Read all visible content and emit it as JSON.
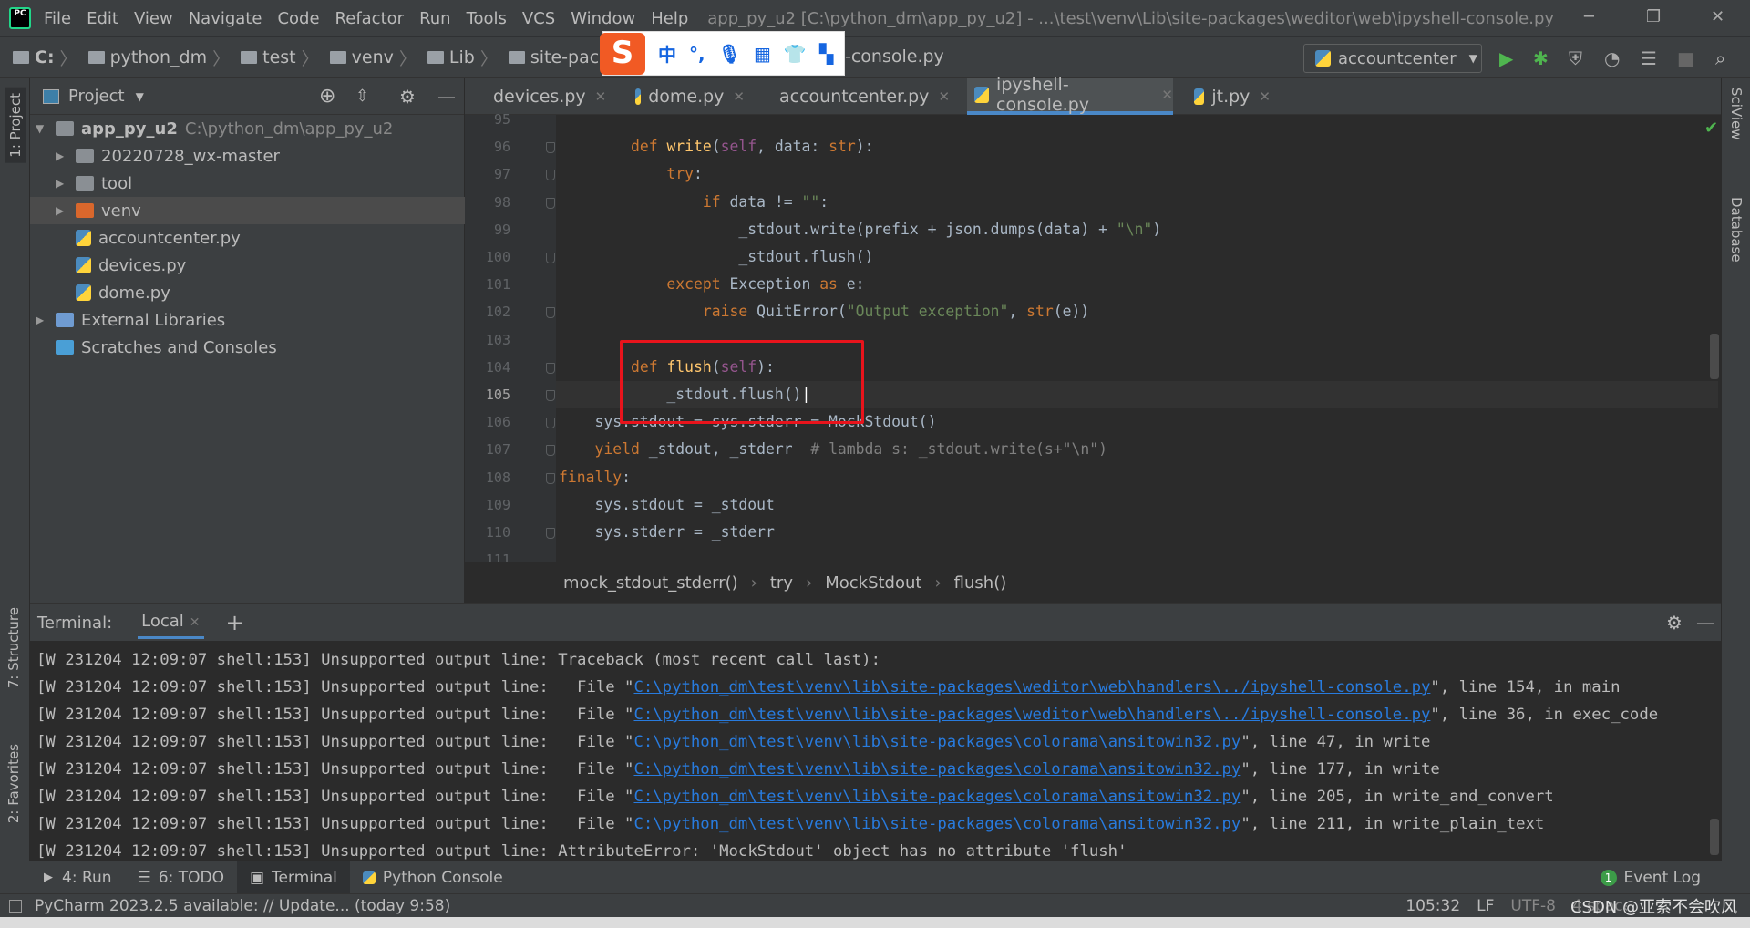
{
  "menubar": {
    "items": [
      "File",
      "Edit",
      "View",
      "Navigate",
      "Code",
      "Refactor",
      "Run",
      "Tools",
      "VCS",
      "Window",
      "Help"
    ],
    "title": "app_py_u2 [C:\\python_dm\\app_py_u2] - ...\\test\\venv\\Lib\\site-packages\\weditor\\web\\ipyshell-console.py"
  },
  "navbar": {
    "crumbs": [
      "C:",
      "python_dm",
      "test",
      "venv",
      "Lib",
      "site-packages",
      "w"
    ],
    "tail": "-console.py",
    "run_config": "accountcenter"
  },
  "ime": {
    "logo": "S",
    "items": [
      "中",
      "°,",
      "mic",
      "keyboard",
      "shirt",
      "grid"
    ]
  },
  "left_strip": {
    "project": "1: Project",
    "structure": "7: Structure",
    "favorites": "2: Favorites"
  },
  "right_strip": {
    "sciview": "SciView",
    "database": "Database"
  },
  "project": {
    "title": "Project",
    "tree": [
      {
        "label": "app_py_u2",
        "hint": "C:\\python_dm\\app_py_u2",
        "type": "folder",
        "depth": 0,
        "expanded": true
      },
      {
        "label": "20220728_wx-master",
        "type": "folder",
        "depth": 1,
        "expanded": false
      },
      {
        "label": "tool",
        "type": "folder",
        "depth": 1,
        "expanded": false
      },
      {
        "label": "venv",
        "type": "venv",
        "depth": 1,
        "expanded": false,
        "selected": true
      },
      {
        "label": "accountcenter.py",
        "type": "py",
        "depth": 1
      },
      {
        "label": "devices.py",
        "type": "py",
        "depth": 1
      },
      {
        "label": "dome.py",
        "type": "py",
        "depth": 1
      },
      {
        "label": "External Libraries",
        "type": "lib",
        "depth": 0,
        "expanded": false
      },
      {
        "label": "Scratches and Consoles",
        "type": "scratch",
        "depth": 0
      }
    ]
  },
  "tabs": [
    {
      "label": "devices.py"
    },
    {
      "label": "dome.py"
    },
    {
      "label": "accountcenter.py"
    },
    {
      "label": "ipyshell-console.py",
      "active": true
    },
    {
      "label": "jt.py"
    }
  ],
  "code": {
    "current_line": 105,
    "lines": [
      {
        "n": 95,
        "t": []
      },
      {
        "n": 96,
        "t": [
          [
            "",
            "        "
          ],
          [
            "k",
            "def "
          ],
          [
            "f",
            "write"
          ],
          [
            "",
            "("
          ],
          [
            "sf",
            "self"
          ],
          [
            "",
            ", data: "
          ],
          [
            "k",
            "str"
          ],
          [
            "",
            "):"
          ]
        ]
      },
      {
        "n": 97,
        "t": [
          [
            "",
            "            "
          ],
          [
            "k",
            "try"
          ],
          [
            "",
            ":"
          ]
        ]
      },
      {
        "n": 98,
        "t": [
          [
            "",
            "                "
          ],
          [
            "k",
            "if "
          ],
          [
            "",
            "data != "
          ],
          [
            "s",
            "\"\""
          ],
          [
            "",
            ":"
          ]
        ]
      },
      {
        "n": 99,
        "t": [
          [
            "",
            "                    _stdout.write(prefix + json.dumps(data) + "
          ],
          [
            "s",
            "\"\\n\""
          ],
          [
            "",
            ")"
          ]
        ]
      },
      {
        "n": 100,
        "t": [
          [
            "",
            "                    _stdout.flush()"
          ]
        ]
      },
      {
        "n": 101,
        "t": [
          [
            "",
            "            "
          ],
          [
            "k",
            "except "
          ],
          [
            "cls",
            "Exception "
          ],
          [
            "k",
            "as "
          ],
          [
            "",
            "e:"
          ]
        ]
      },
      {
        "n": 102,
        "t": [
          [
            "",
            "                "
          ],
          [
            "k",
            "raise "
          ],
          [
            "",
            "QuitError("
          ],
          [
            "s",
            "\"Output exception\""
          ],
          [
            "",
            ", "
          ],
          [
            "k",
            "str"
          ],
          [
            "",
            "(e))"
          ]
        ]
      },
      {
        "n": 103,
        "t": []
      },
      {
        "n": 104,
        "t": [
          [
            "",
            "        "
          ],
          [
            "k",
            "def "
          ],
          [
            "f",
            "flush"
          ],
          [
            "",
            "("
          ],
          [
            "sf",
            "self"
          ],
          [
            "",
            "):"
          ]
        ]
      },
      {
        "n": 105,
        "t": [
          [
            "",
            "            _stdout.flush()"
          ]
        ]
      },
      {
        "n": 106,
        "t": [
          [
            "",
            "    sys.stdout = sys.stderr = MockStdout()"
          ]
        ]
      },
      {
        "n": 107,
        "t": [
          [
            "",
            "    "
          ],
          [
            "k",
            "yield "
          ],
          [
            "",
            "_stdout, _stderr  "
          ],
          [
            "c",
            "# lambda s: _stdout.write(s+\"\\n\")"
          ]
        ]
      },
      {
        "n": 108,
        "t": [
          [
            "",
            ""
          ],
          [
            "k",
            "finally"
          ],
          [
            "",
            ":"
          ]
        ]
      },
      {
        "n": 109,
        "t": [
          [
            "",
            "    sys.stdout = _stdout"
          ]
        ]
      },
      {
        "n": 110,
        "t": [
          [
            "",
            "    sys.stderr = _stderr"
          ]
        ]
      },
      {
        "n": 111,
        "t": []
      }
    ]
  },
  "breadcrumb": [
    "mock_stdout_stderr()",
    "try",
    "MockStdout",
    "flush()"
  ],
  "terminal": {
    "title": "Terminal:",
    "tab": "Local",
    "lines": [
      {
        "p": "[W 231204 12:09:07 shell:153] Unsupported output line: Traceback (most recent call last):"
      },
      {
        "p": "[W 231204 12:09:07 shell:153] Unsupported output line:   File \"",
        "link": "C:\\python_dm\\test\\venv\\lib\\site-packages\\weditor\\web\\handlers\\../ipyshell-console.py",
        "s": "\", line 154, in main"
      },
      {
        "p": "[W 231204 12:09:07 shell:153] Unsupported output line:   File \"",
        "link": "C:\\python_dm\\test\\venv\\lib\\site-packages\\weditor\\web\\handlers\\../ipyshell-console.py",
        "s": "\", line 36, in exec_code"
      },
      {
        "p": "[W 231204 12:09:07 shell:153] Unsupported output line:   File \"",
        "link": "C:\\python_dm\\test\\venv\\lib\\site-packages\\colorama\\ansitowin32.py",
        "s": "\", line 47, in write"
      },
      {
        "p": "[W 231204 12:09:07 shell:153] Unsupported output line:   File \"",
        "link": "C:\\python_dm\\test\\venv\\lib\\site-packages\\colorama\\ansitowin32.py",
        "s": "\", line 177, in write"
      },
      {
        "p": "[W 231204 12:09:07 shell:153] Unsupported output line:   File \"",
        "link": "C:\\python_dm\\test\\venv\\lib\\site-packages\\colorama\\ansitowin32.py",
        "s": "\", line 205, in write_and_convert"
      },
      {
        "p": "[W 231204 12:09:07 shell:153] Unsupported output line:   File \"",
        "link": "C:\\python_dm\\test\\venv\\lib\\site-packages\\colorama\\ansitowin32.py",
        "s": "\", line 211, in write_plain_text"
      },
      {
        "p": "[W 231204 12:09:07 shell:153] Unsupported output line: AttributeError: 'MockStdout' object has no attribute 'flush'"
      }
    ]
  },
  "bottom_tabs": {
    "run": "4: Run",
    "todo": "6: TODO",
    "terminal": "Terminal",
    "python_console": "Python Console",
    "event_log": "Event Log",
    "event_count": "1"
  },
  "status": {
    "message": "PyCharm 2023.2.5 available: // Update... (today 9:58)",
    "position": "105:32",
    "line_sep": "LF",
    "encoding": "UTF-8",
    "indent": "4 spaces",
    "watermark": "CSDN @亚索不会吹风"
  },
  "colors": {
    "keyword": "#cc7832",
    "string": "#6a8759",
    "function": "#ffc66d",
    "self": "#94558d",
    "link": "#287bde",
    "highlight_box": "#e8141c"
  }
}
